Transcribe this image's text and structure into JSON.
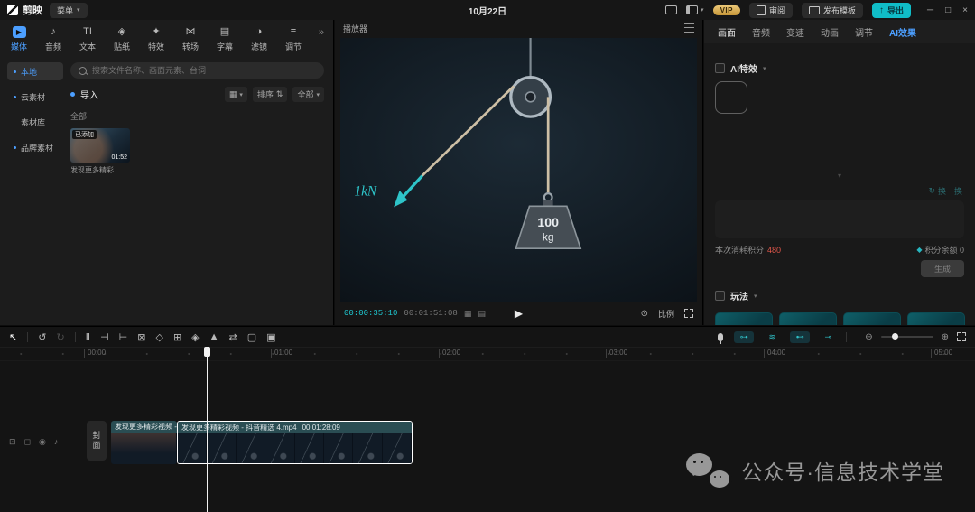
{
  "titlebar": {
    "logo_text": "剪映",
    "menu_label": "菜单",
    "date": "10月22日",
    "vip_label": "VIP",
    "review_label": "审阅",
    "publish_label": "发布模板",
    "export_label": "导出",
    "export_glyph": "↑",
    "caret": "▾",
    "min_glyph": "─",
    "max_glyph": "□",
    "close_glyph": "×"
  },
  "media_tabs": {
    "active": "媒体",
    "items": [
      {
        "label": "媒体",
        "glyph": "▶"
      },
      {
        "label": "音频",
        "glyph": "♪"
      },
      {
        "label": "文本",
        "glyph": "TI"
      },
      {
        "label": "贴纸",
        "glyph": "◈"
      },
      {
        "label": "特效",
        "glyph": "✦"
      },
      {
        "label": "转场",
        "glyph": "⋈"
      },
      {
        "label": "字幕",
        "glyph": "▤"
      },
      {
        "label": "滤镜",
        "glyph": "◑"
      },
      {
        "label": "调节",
        "glyph": "≡"
      }
    ],
    "more_glyph": "»"
  },
  "library": {
    "sections": [
      {
        "label": "本地"
      },
      {
        "label": "云素材"
      },
      {
        "label": "素材库"
      },
      {
        "label": "品牌素材"
      }
    ],
    "search_placeholder": "搜索文件名称、画面元素、台词",
    "import_label": "导入",
    "view_glyph": "▦",
    "sort_label": "排序",
    "sort_glyph": "⇅",
    "filter_label": "全部",
    "filter_glyph": "▾",
    "section_label": "全部",
    "clip": {
      "added_badge": "已添加",
      "duration": "01:52",
      "name": "发现更多精彩..._4.mp4"
    }
  },
  "player": {
    "title": "播放器",
    "current_time": "00:00:35:10",
    "total_time": "00:01:51:08",
    "quality_glyph_1": "▦",
    "quality_glyph_2": "▤",
    "play_glyph": "▶",
    "snapshot_glyph": "⊙",
    "ratio_label": "比例",
    "scene": {
      "force_label": "1kN",
      "weight_value": "100",
      "weight_unit": "kg"
    }
  },
  "inspector": {
    "tabs": [
      "画面",
      "音频",
      "变速",
      "动画",
      "调节",
      "AI效果"
    ],
    "active_tab": "AI效果",
    "ai_effects_label": "AI特效",
    "chevron": "▾",
    "refresh_glyph": "↻",
    "refresh_label": "换一换",
    "cost_label": "本次消耗积分",
    "cost_value": "480",
    "points_glyph": "◆",
    "balance_label": "积分余额 0",
    "generate_label": "生成",
    "play_section_label": "玩法"
  },
  "timeline": {
    "tools": [
      {
        "name": "select",
        "glyph": "↖"
      },
      {
        "name": "undo",
        "glyph": "↺"
      },
      {
        "name": "redo",
        "glyph": "↻"
      },
      {
        "name": "split",
        "glyph": "Ⅱ"
      },
      {
        "name": "delete-left",
        "glyph": "⊣"
      },
      {
        "name": "delete-right",
        "glyph": "⊢"
      },
      {
        "name": "delete",
        "glyph": "⊠"
      },
      {
        "name": "mask",
        "glyph": "◇"
      },
      {
        "name": "copy",
        "glyph": "⊞"
      },
      {
        "name": "keyframe",
        "glyph": "◈"
      },
      {
        "name": "mirror",
        "glyph": "▲"
      },
      {
        "name": "flip",
        "glyph": "⇄"
      },
      {
        "name": "crop",
        "glyph": "▢"
      },
      {
        "name": "matting",
        "glyph": "▣"
      }
    ],
    "track_toggles": [
      "⊶",
      "≋",
      "⊷",
      "⊸"
    ],
    "zoom_out_glyph": "⊖",
    "zoom_in_glyph": "⊕",
    "ruler": [
      "00:00",
      "01:00",
      "02:00",
      "03:00",
      "04:00",
      "05:00"
    ],
    "gutter_icons": [
      "⊡",
      "◻",
      "◉",
      "♪"
    ],
    "cover_label": "封面",
    "clip1": {
      "title": "发现更多精彩视频 - 抖"
    },
    "clip2": {
      "title": "发现更多精彩视频 - 抖音精选 4.mp4",
      "duration": "00:01:28:09"
    }
  },
  "watermark": {
    "text": "公众号·信息技术学堂"
  }
}
